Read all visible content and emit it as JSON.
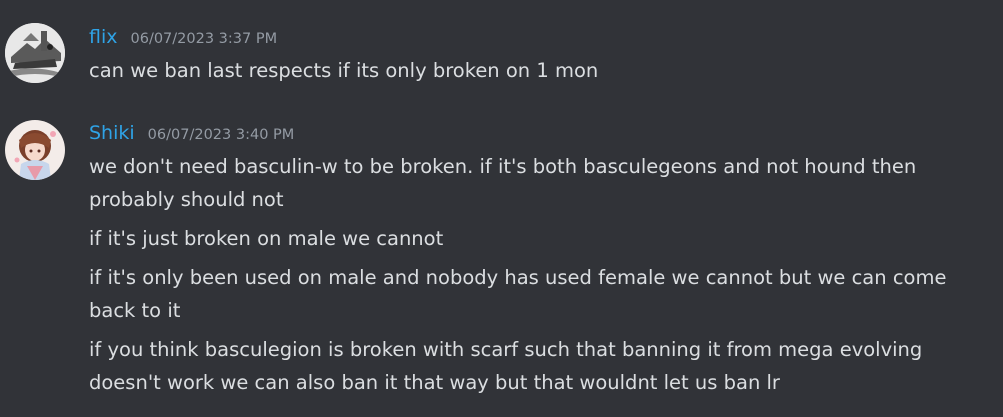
{
  "messages": [
    {
      "author": "flix",
      "timestamp": "06/07/2023 3:37 PM",
      "avatar": "flix-avatar",
      "lines": [
        "can we ban last respects if its only broken on 1 mon"
      ]
    },
    {
      "author": "Shiki",
      "timestamp": "06/07/2023 3:40 PM",
      "avatar": "shiki-avatar",
      "lines": [
        "we don't need basculin-w to be broken. if it's both basculegeons and not hound then",
        "probably should not",
        "if it's just broken on male we cannot",
        "if it's only been used on male and nobody has used female we cannot but we can come",
        "back to it",
        "if you think basculegion is broken with scarf such that banning it from mega evolving",
        "doesn't work we can also ban it that way but that wouldnt let us ban lr"
      ]
    }
  ],
  "colors": {
    "background": "#313338",
    "username": "#2fa3e6",
    "timestamp": "#949ba4",
    "text": "#dbdee1"
  }
}
